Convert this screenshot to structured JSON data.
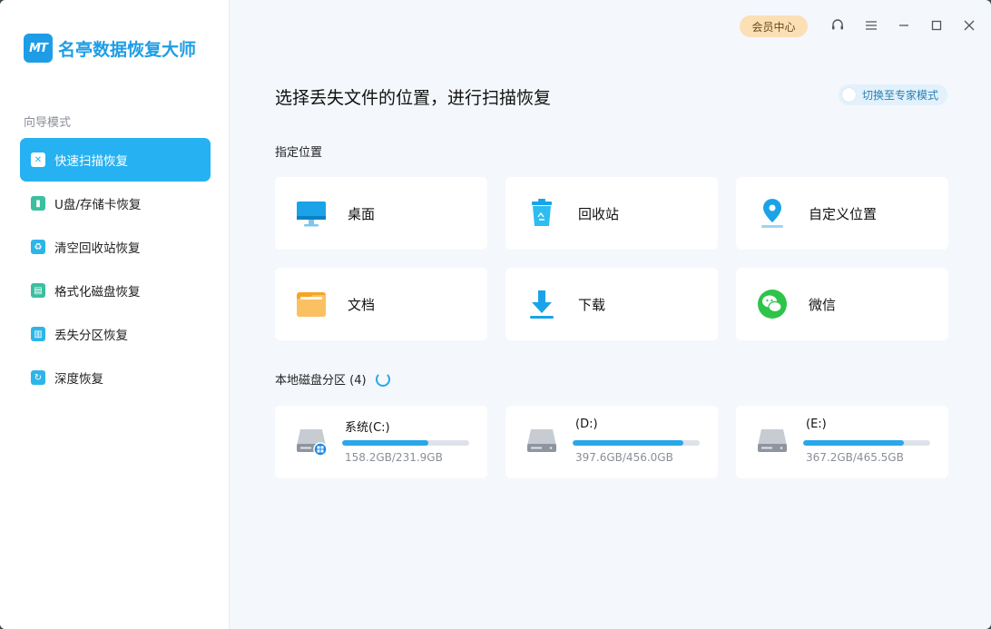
{
  "app": {
    "logo_text": "MT",
    "name": "名亭数据恢复大师"
  },
  "titlebar": {
    "vip_label": "会员中心",
    "icons": [
      "headset-icon",
      "menu-icon",
      "minimize-icon",
      "maximize-icon",
      "close-icon"
    ]
  },
  "sidebar": {
    "section_label": "向导模式",
    "items": [
      {
        "label": "快速扫描恢复",
        "icon": "quick-scan-icon",
        "active": true
      },
      {
        "label": "U盘/存储卡恢复",
        "icon": "usb-card-icon",
        "active": false
      },
      {
        "label": "清空回收站恢复",
        "icon": "recycle-bin-icon",
        "active": false
      },
      {
        "label": "格式化磁盘恢复",
        "icon": "format-disk-icon",
        "active": false
      },
      {
        "label": "丢失分区恢复",
        "icon": "lost-partition-icon",
        "active": false
      },
      {
        "label": "深度恢复",
        "icon": "deep-recovery-icon",
        "active": false
      }
    ]
  },
  "main": {
    "title": "选择丢失文件的位置，进行扫描恢复",
    "expert_toggle_label": "切换至专家模式",
    "locations_title": "指定位置",
    "locations": [
      {
        "label": "桌面",
        "icon": "desktop-icon"
      },
      {
        "label": "回收站",
        "icon": "trash-icon"
      },
      {
        "label": "自定义位置",
        "icon": "location-pin-icon"
      },
      {
        "label": "文档",
        "icon": "folder-icon"
      },
      {
        "label": "下载",
        "icon": "download-icon"
      },
      {
        "label": "微信",
        "icon": "wechat-icon"
      }
    ],
    "disks_title": "本地磁盘分区 (4)",
    "disks": [
      {
        "name": "系统(C:)",
        "size": "158.2GB/231.9GB",
        "used_fraction": 0.68,
        "system": true
      },
      {
        "name": "(D:)",
        "size": "397.6GB/456.0GB",
        "used_fraction": 0.87,
        "system": false
      },
      {
        "name": "(E:)",
        "size": "367.2GB/465.5GB",
        "used_fraction": 0.79,
        "system": false
      }
    ]
  },
  "colors": {
    "accent": "#26b1f2",
    "brand": "#1e9de6",
    "vip_bg": "#fbe0b5",
    "progress": "#29a7ea"
  }
}
